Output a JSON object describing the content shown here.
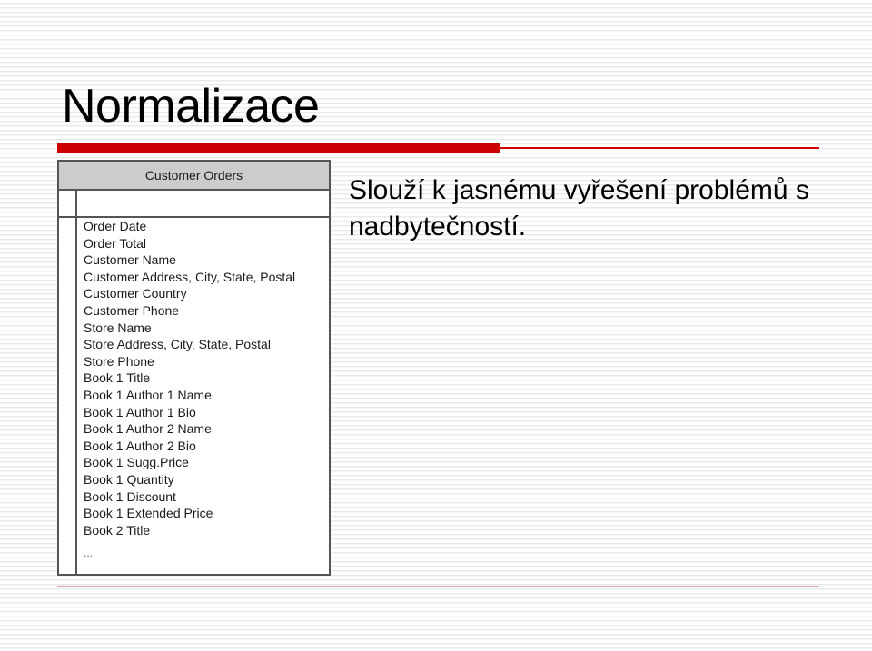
{
  "slide": {
    "title": "Normalizace",
    "body_text": "Slouží k jasnému vyřešení problémů s nadbytečností.",
    "accent_color": "#cc0000",
    "title_color": "#000000",
    "background_color": "#ffffff",
    "bottom_rule_color": "#dba8a8"
  },
  "entity_table": {
    "header": "Customer Orders",
    "header_background": "#cccccc",
    "border_color": "#555555",
    "ellipsis": "...",
    "fields": [
      "Order Date",
      "Order Total",
      "Customer Name",
      "Customer Address, City, State, Postal",
      "Customer Country",
      "Customer Phone",
      "Store Name",
      "Store Address, City, State, Postal",
      "Store Phone",
      "Book 1 Title",
      "Book 1 Author 1 Name",
      "Book 1 Author 1 Bio",
      "Book 1 Author 2  Name",
      "Book 1 Author 2 Bio",
      "Book 1 Sugg.Price",
      "Book 1 Quantity",
      "Book 1 Discount",
      "Book 1 Extended Price",
      "Book 2 Title"
    ]
  }
}
